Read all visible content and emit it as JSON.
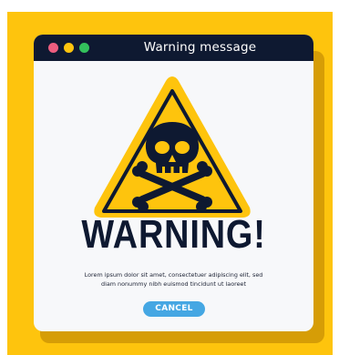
{
  "window": {
    "title": "Warning message",
    "controls": [
      "close",
      "minimize",
      "maximize"
    ]
  },
  "sign": {
    "icon": "skull-crossbones-warning-icon"
  },
  "headline": "WARNING!",
  "message": {
    "line1": "Lorem ipsum dolor sit amet, consectetuer adipiscing elit, sed",
    "line2": "diam nonummy nibh euismod tincidunt ut laoreet"
  },
  "cancel_button": "CANCEL",
  "colors": {
    "background": "#fec40d",
    "titlebar": "#0e1931",
    "button": "#45a7e3",
    "dot_red": "#ec5d7f",
    "dot_yellow": "#fdc40e",
    "dot_green": "#33c15c"
  }
}
